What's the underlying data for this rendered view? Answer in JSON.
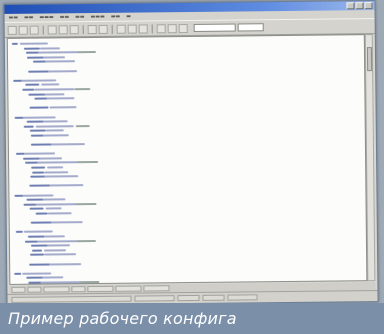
{
  "caption": {
    "text": "Пример рабочего конфига"
  },
  "window": {
    "icons": {
      "minimize": "minimize-icon",
      "maximize": "maximize-icon",
      "close": "close-icon"
    }
  },
  "colors": {
    "caption_background": "#7b8fa8",
    "caption_text": "#ffffff",
    "titlebar": "#1f4fb6",
    "editor_background": "#fcfcfa",
    "code_keyword": "#6f7fb3",
    "code_text": "#a3aacb"
  }
}
